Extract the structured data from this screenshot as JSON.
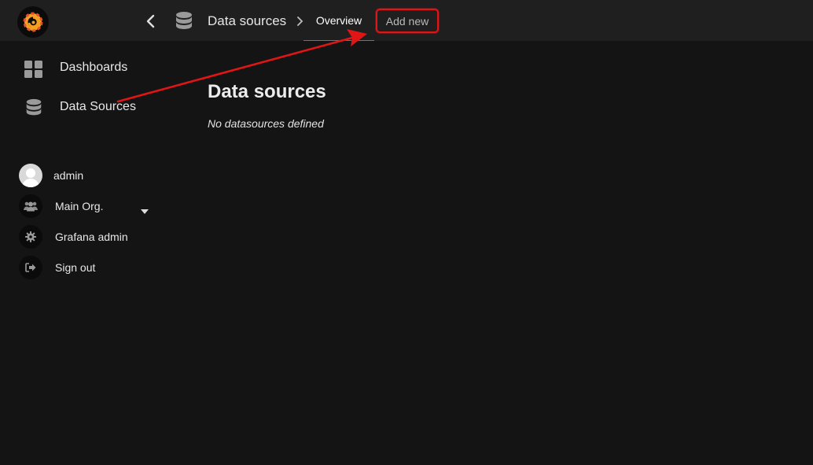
{
  "header": {
    "breadcrumb_title": "Data sources",
    "tabs": [
      {
        "label": "Overview",
        "active": true
      },
      {
        "label": "Add new",
        "highlighted": true
      }
    ]
  },
  "sidebar": {
    "items": [
      {
        "label": "Dashboards",
        "icon": "dashboards-grid-icon"
      },
      {
        "label": "Data Sources",
        "icon": "database-icon"
      }
    ],
    "user_menu": [
      {
        "label": "admin",
        "icon": "user-avatar-icon"
      },
      {
        "label": "Main Org.",
        "icon": "users-icon",
        "has_dropdown": true
      },
      {
        "label": "Grafana admin",
        "icon": "gear-icon"
      },
      {
        "label": "Sign out",
        "icon": "sign-out-icon"
      }
    ]
  },
  "main": {
    "title": "Data sources",
    "empty_message": "No datasources defined"
  },
  "colors": {
    "background": "#141414",
    "topbar": "#1f1f1f",
    "highlight_red": "#e11515",
    "active_tab_underline": "#3d7fb8",
    "logo_orange": "#f6a022"
  }
}
